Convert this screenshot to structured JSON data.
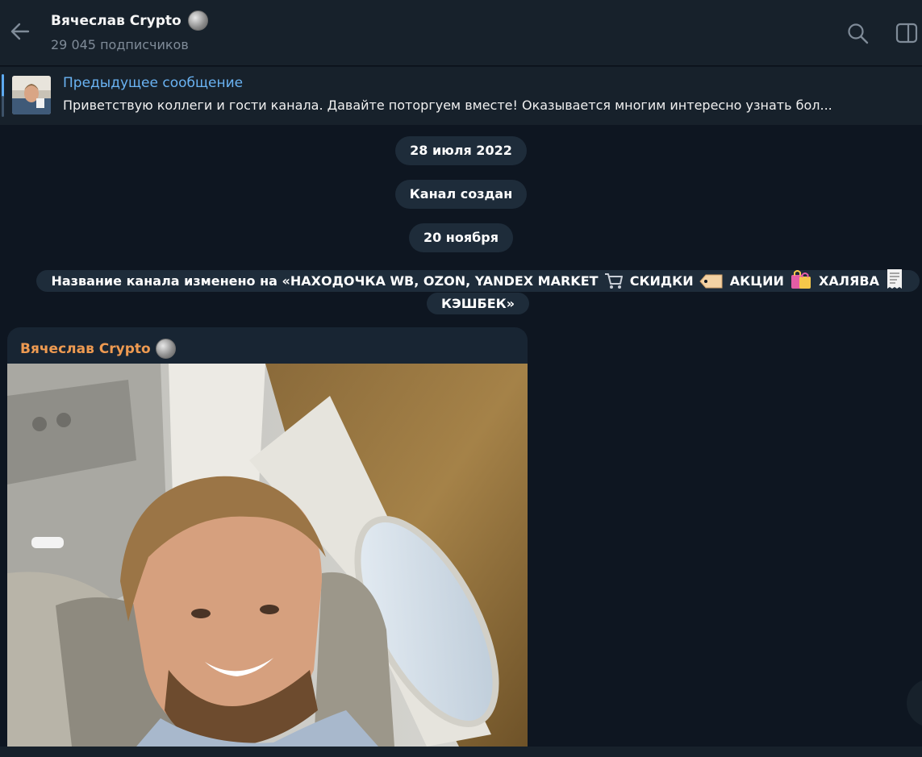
{
  "header": {
    "title": "Вячеслав Crypto",
    "subscribers": "29 045 подписчиков",
    "back_icon": "arrow-left-icon",
    "search_icon": "search-icon",
    "panel_icon": "sidebar-panel-icon"
  },
  "pinned": {
    "title": "Предыдущее сообщение",
    "text": "Приветствую коллеги и гости канала. Давайте поторгуем вместе!  Оказывается многим интересно узнать бол..."
  },
  "service": {
    "date1": "28 июля 2022",
    "created": "Канал создан",
    "date2": "20 ноября",
    "rename_part1": "Название канала изменено на «НАХОДОЧКА WB, OZON, YANDEX MARKET",
    "rename_part2": "СКИДКИ",
    "rename_part3": "АКЦИИ",
    "rename_part4": "ХАЛЯВА",
    "rename_part5": "КЭШБЕК»"
  },
  "message": {
    "author": "Вячеслав Crypto"
  },
  "colors": {
    "background": "#0e1621",
    "header": "#17212b",
    "accent": "#6ab3f3",
    "author": "#ee9a51",
    "service_pill": "#1e2c3a"
  }
}
